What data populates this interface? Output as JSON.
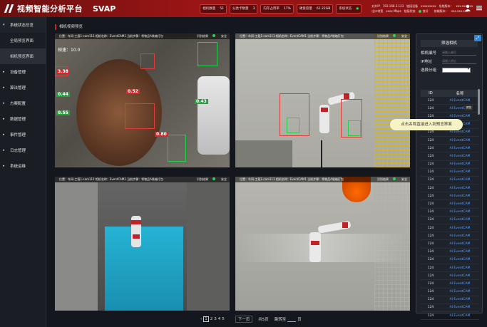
{
  "header": {
    "app_title": "视频智能分析平台",
    "brand": "SVAP",
    "stats": [
      {
        "label": "相机数量",
        "value": "51"
      },
      {
        "label": "分类卡数量",
        "value": "3"
      },
      {
        "label": "内存占用率",
        "value": "17%"
      },
      {
        "label": "硬盘容量",
        "value": "61.22GB"
      },
      {
        "label": "系统状态",
        "value": "●"
      }
    ],
    "sysinfo": {
      "row1": [
        "对外IP",
        "192.168.3.123",
        "链接设备",
        "xxxxxxxxx",
        "系统版本：",
        "xxx.xxx.xxx"
      ],
      "row2": [
        "出口带宽",
        "xxxx Mbps",
        "链接状态",
        "良好",
        "前端版本：",
        "xxx.xxx.xxx"
      ]
    }
  },
  "sidebar": {
    "items": [
      {
        "label": "系统状态总览",
        "chev": "▾"
      },
      {
        "label": "全局预览界面",
        "sub": true
      },
      {
        "label": "相机预览界面",
        "sub": true,
        "active": true
      },
      {
        "label": "设备管理",
        "chev": "▸"
      },
      {
        "label": "算法管理",
        "chev": "▸"
      },
      {
        "label": "方案配置",
        "chev": "▸"
      },
      {
        "label": "数据管理",
        "chev": "▸"
      },
      {
        "label": "事件管理",
        "chev": "▸"
      },
      {
        "label": "日志管理",
        "chev": "▸"
      },
      {
        "label": "系统运维",
        "chev": "▸"
      }
    ]
  },
  "breadcrumb": "相机视频预览",
  "cameras": [
    {
      "hdr": "位置：车间-工段1-cam111 相机名称：EventCAM1 当前步骤：将物品A装箱打包",
      "state1": "识别结果",
      "state2": "安全"
    },
    {
      "hdr": "位置：车间-工段1-cam111 相机名称：EventCAM1 当前步骤：将物品A装箱打包",
      "state1": "识别结果",
      "state2": "安全"
    },
    {
      "hdr": "位置：车间-工段1-cam111 相机名称：EventCAM1 当前步骤：将物品A装箱打包",
      "state1": "识别结果",
      "state2": "安全"
    },
    {
      "hdr": "位置：车间-工段1-cam111 相机名称：EventCAM1 当前步骤：将物品A装箱打包",
      "state1": "识别结果",
      "state2": "安全"
    }
  ],
  "cam1_overlay": {
    "line1": "帧速：10.0",
    "tags": [
      "3.38",
      "0.44",
      "0.55",
      "0.80",
      "0.43",
      "0.52"
    ]
  },
  "filter": {
    "title": "筛选相机",
    "camera_no_label": "相机编号",
    "camera_no_placeholder": "请输入编号",
    "ip_label": "IP地址",
    "ip_placeholder": "请输入地址",
    "group_label": "选择分组"
  },
  "table": {
    "col_id": "ID",
    "col_name": "名称",
    "rows": [
      {
        "id": "124",
        "name": "AI EventCAM"
      },
      {
        "id": "124",
        "name": "AI EventCAM"
      },
      {
        "id": "124",
        "name": "AI EventCAM"
      },
      {
        "id": "124",
        "name": "AI EventCAM"
      },
      {
        "id": "124",
        "name": "AI EventCAM"
      },
      {
        "id": "124",
        "name": "AI EventCAM"
      },
      {
        "id": "124",
        "name": "AI EventCAM"
      },
      {
        "id": "124",
        "name": "AI EventCAM"
      },
      {
        "id": "124",
        "name": "AI EventCAM"
      },
      {
        "id": "124",
        "name": "AI EventCAM"
      },
      {
        "id": "124",
        "name": "AI EventCAM"
      },
      {
        "id": "124",
        "name": "AI EventCAM"
      },
      {
        "id": "124",
        "name": "AI EventCAM"
      },
      {
        "id": "124",
        "name": "AI EventCAM"
      },
      {
        "id": "124",
        "name": "AI EventCAM"
      },
      {
        "id": "124",
        "name": "AI EventCAM"
      },
      {
        "id": "124",
        "name": "AI EventCAM"
      },
      {
        "id": "124",
        "name": "AI EventCAM"
      },
      {
        "id": "124",
        "name": "AI EventCAM"
      },
      {
        "id": "124",
        "name": "AI EventCAM"
      },
      {
        "id": "124",
        "name": "AI EventCAM"
      },
      {
        "id": "124",
        "name": "AI EventCAM"
      },
      {
        "id": "124",
        "name": "AI EventCAM"
      },
      {
        "id": "124",
        "name": "AI EventCAM"
      },
      {
        "id": "124",
        "name": "AI EventCAM"
      },
      {
        "id": "124",
        "name": "AI EventCAM"
      },
      {
        "id": "124",
        "name": "AI EventCAM"
      },
      {
        "id": "124",
        "name": "AI EventCAM"
      }
    ]
  },
  "tooltip": "点击名称直接进入到预览界面",
  "tiny_tip": "预览",
  "pager": {
    "pages": [
      "1",
      "2",
      "3",
      "4",
      "5"
    ],
    "current": "1",
    "prev": "‹",
    "next_label": "下一页",
    "total": "共5页",
    "jump_label": "跳转至",
    "page_unit": "页"
  },
  "colors": {
    "accent": "#9b1515",
    "link": "#5aa0ff",
    "ok": "#2ed35a"
  }
}
